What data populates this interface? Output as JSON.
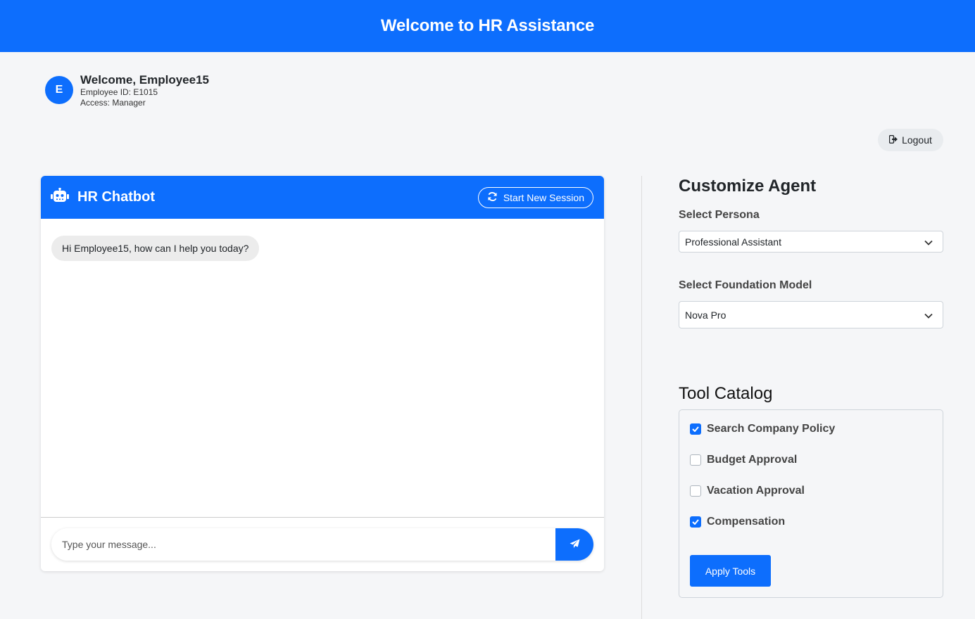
{
  "header": {
    "title": "Welcome to HR Assistance"
  },
  "user": {
    "avatar_initial": "E",
    "welcome": "Welcome, Employee15",
    "employee_id": "Employee ID: E1015",
    "access": "Access: Manager"
  },
  "logout": {
    "label": "Logout",
    "icon": "sign-out-icon"
  },
  "chat": {
    "title": "HR Chatbot",
    "icon": "robot-icon",
    "new_session_label": "Start New Session",
    "messages": [
      {
        "sender": "bot",
        "text": "Hi Employee15, how can I help you today?"
      }
    ],
    "input_placeholder": "Type your message...",
    "input_value": "",
    "send_icon": "paper-plane-icon"
  },
  "customize": {
    "title": "Customize Agent",
    "persona_label": "Select Persona",
    "persona_value": "Professional Assistant",
    "model_label": "Select Foundation Model",
    "model_value": "Nova Pro"
  },
  "tools": {
    "title": "Tool Catalog",
    "items": [
      {
        "label": "Search Company Policy",
        "checked": true
      },
      {
        "label": "Budget Approval",
        "checked": false
      },
      {
        "label": "Vacation Approval",
        "checked": false
      },
      {
        "label": "Compensation",
        "checked": true
      }
    ],
    "apply_label": "Apply Tools"
  },
  "colors": {
    "primary": "#0d6efd",
    "background": "#f5f6f8",
    "bubble": "#ececec"
  }
}
